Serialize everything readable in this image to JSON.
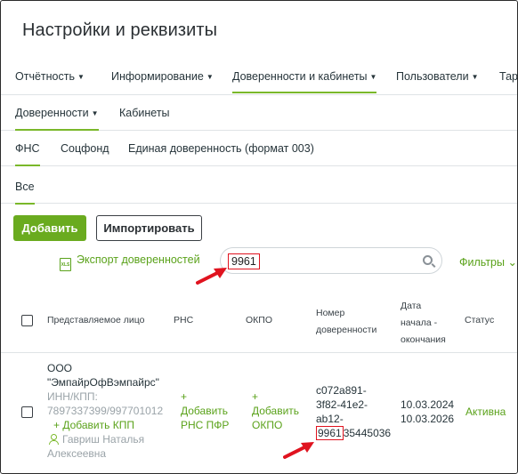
{
  "page_title": "Настройки и реквизиты",
  "nav_main": [
    {
      "label": "Отчётность",
      "caret": "▼"
    },
    {
      "label": "Информирование",
      "caret": "▼"
    },
    {
      "label": "Доверенности и кабинеты",
      "caret": "▼"
    },
    {
      "label": "Пользователи",
      "caret": "▼"
    },
    {
      "label": "Тар"
    }
  ],
  "nav_sub": [
    {
      "label": "Доверенности",
      "caret": "▼"
    },
    {
      "label": "Кабинеты"
    }
  ],
  "nav_tabs": [
    {
      "label": "ФНС"
    },
    {
      "label": "Соцфонд"
    },
    {
      "label": "Единая доверенность (формат 003)"
    }
  ],
  "nav_filter": {
    "label": "Все"
  },
  "actions": {
    "add": "Добавить",
    "import": "Импортировать"
  },
  "export": {
    "label": "Экспорт доверенностей",
    "icon": "xls-icon",
    "icon_text": "XLS"
  },
  "search": {
    "value": "9961"
  },
  "filters": {
    "label": "Фильтры",
    "caret": "⌄"
  },
  "table": {
    "headers": {
      "person": "Представляемое лицо",
      "rns": "РНС",
      "okpo": "ОКПО",
      "number_l1": "Номер",
      "number_l2": "доверенности",
      "date_l1": "Дата",
      "date_l2": "начала -",
      "date_l3": "окончания",
      "status": "Статус"
    },
    "rows": [
      {
        "org_l1": "ООО",
        "org_l2": "\"ЭмпайрОфВэмпайрс\"",
        "inn_label": "ИНН/КПП:",
        "inn_value": "7897337399/997701012",
        "add_kpp": "+ Добавить КПП",
        "person_l1": "Гавриш Наталья",
        "person_l2": "Алексеевна",
        "rns_l1": "+",
        "rns_l2": "Добавить",
        "rns_l3": "РНС ПФР",
        "okpo_l1": "+",
        "okpo_l2": "Добавить",
        "okpo_l3": "ОКПО",
        "num_l1": "c072a891-",
        "num_l2": "3f82-41e2-",
        "num_l3": "ab12-",
        "num_l4_hl": "9961",
        "num_l4_rest": "35445036",
        "date_start": "10.03.2024",
        "date_end": "10.03.2026",
        "status": "Активна"
      }
    ]
  },
  "colors": {
    "accent": "#6aab1f",
    "link": "#5aa21a",
    "highlight": "#e0131f",
    "arrow": "#e0131f"
  }
}
